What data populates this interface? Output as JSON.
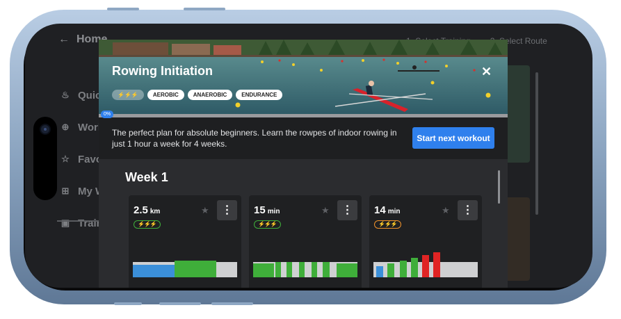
{
  "background": {
    "header_title": "Home",
    "steps": [
      "1. Select Training",
      "2. Select Route"
    ],
    "nav": [
      {
        "label": "Quick",
        "icon": "flame-icon"
      },
      {
        "label": "Workouts",
        "icon": "dumbbell-icon"
      },
      {
        "label": "Favorites",
        "icon": "star-icon"
      },
      {
        "label": "My Workouts",
        "icon": "grid-icon"
      },
      {
        "label": "Training",
        "icon": "calendar-icon"
      }
    ]
  },
  "modal": {
    "title": "Rowing Initiation",
    "close_label": "✕",
    "tags": [
      "AEROBIC",
      "ANAEROBIC",
      "ENDURANCE"
    ],
    "level_tag": "⚡⚡⚡",
    "progress": {
      "percent": 0,
      "label": "0%"
    },
    "description": "The perfect plan for absolute beginners. Learn the rowpes of indoor rowing in just 1 hour a week for 4 weeks.",
    "start_button": "Start next workout",
    "week_title": "Week 1",
    "cards": [
      {
        "value": "2.5",
        "unit": "km",
        "intensity": "⚡⚡⚡",
        "intensity_color": "#3fae3a",
        "menu": "⋮"
      },
      {
        "value": "15",
        "unit": "min",
        "intensity": "⚡⚡⚡",
        "intensity_color": "#3fae3a",
        "menu": "⋮"
      },
      {
        "value": "14",
        "unit": "min",
        "intensity": "⚡⚡⚡",
        "intensity_color": "#f0922b",
        "menu": "⋮"
      }
    ]
  },
  "colors": {
    "accent": "#2f80ed",
    "green": "#3fae3a",
    "blue": "#3b8fd9",
    "red": "#e02424",
    "grey": "#cfd0d2"
  }
}
